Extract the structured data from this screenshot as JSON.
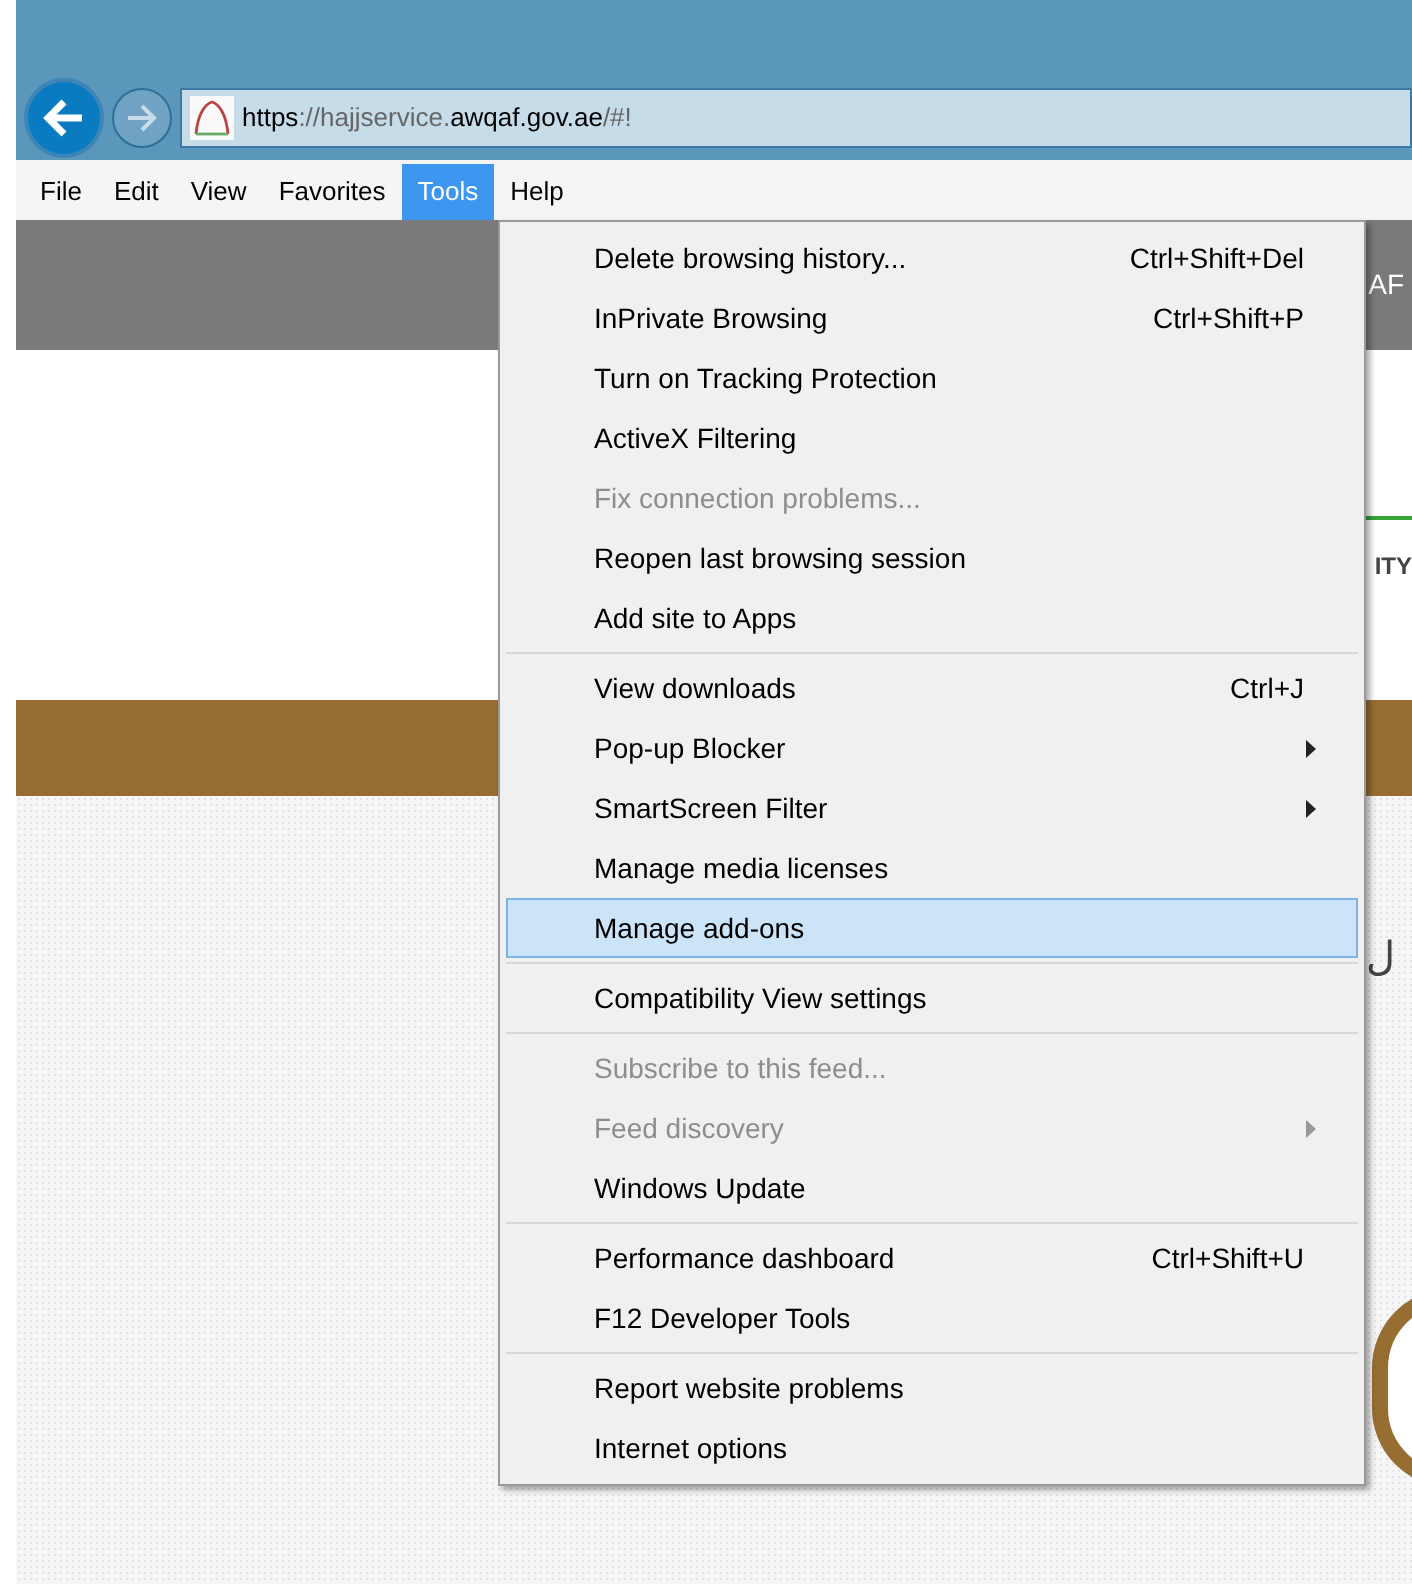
{
  "address_bar": {
    "scheme": "https",
    "separator": "://",
    "subdomain": "hajjservice.",
    "domain": "awqaf.gov.ae",
    "path": "/#!"
  },
  "menu_bar": [
    {
      "label": "File",
      "selected": false
    },
    {
      "label": "Edit",
      "selected": false
    },
    {
      "label": "View",
      "selected": false
    },
    {
      "label": "Favorites",
      "selected": false
    },
    {
      "label": "Tools",
      "selected": true
    },
    {
      "label": "Help",
      "selected": false
    }
  ],
  "page": {
    "header_fragment": "AF",
    "nav_fragment": "ITY",
    "body_fragment": "ل"
  },
  "tools_menu": [
    [
      {
        "label": "Delete browsing history...",
        "shortcut": "Ctrl+Shift+Del",
        "disabled": false,
        "submenu": false,
        "selected": false
      },
      {
        "label": "InPrivate Browsing",
        "shortcut": "Ctrl+Shift+P",
        "disabled": false,
        "submenu": false,
        "selected": false
      },
      {
        "label": "Turn on Tracking Protection",
        "disabled": false,
        "submenu": false,
        "selected": false
      },
      {
        "label": "ActiveX Filtering",
        "disabled": false,
        "submenu": false,
        "selected": false
      },
      {
        "label": "Fix connection problems...",
        "disabled": true,
        "submenu": false,
        "selected": false
      },
      {
        "label": "Reopen last browsing session",
        "disabled": false,
        "submenu": false,
        "selected": false
      },
      {
        "label": "Add site to Apps",
        "disabled": false,
        "submenu": false,
        "selected": false
      }
    ],
    [
      {
        "label": "View downloads",
        "shortcut": "Ctrl+J",
        "disabled": false,
        "submenu": false,
        "selected": false
      },
      {
        "label": "Pop-up Blocker",
        "disabled": false,
        "submenu": true,
        "selected": false
      },
      {
        "label": "SmartScreen Filter",
        "disabled": false,
        "submenu": true,
        "selected": false
      },
      {
        "label": "Manage media licenses",
        "disabled": false,
        "submenu": false,
        "selected": false
      },
      {
        "label": "Manage add-ons",
        "disabled": false,
        "submenu": false,
        "selected": true
      }
    ],
    [
      {
        "label": "Compatibility View settings",
        "disabled": false,
        "submenu": false,
        "selected": false
      }
    ],
    [
      {
        "label": "Subscribe to this feed...",
        "disabled": true,
        "submenu": false,
        "selected": false
      },
      {
        "label": "Feed discovery",
        "disabled": true,
        "submenu": true,
        "selected": false
      },
      {
        "label": "Windows Update",
        "disabled": false,
        "submenu": false,
        "selected": false
      }
    ],
    [
      {
        "label": "Performance dashboard",
        "shortcut": "Ctrl+Shift+U",
        "disabled": false,
        "submenu": false,
        "selected": false
      },
      {
        "label": "F12 Developer Tools",
        "disabled": false,
        "submenu": false,
        "selected": false
      }
    ],
    [
      {
        "label": "Report website problems",
        "disabled": false,
        "submenu": false,
        "selected": false
      },
      {
        "label": "Internet options",
        "disabled": false,
        "submenu": false,
        "selected": false
      }
    ]
  ]
}
